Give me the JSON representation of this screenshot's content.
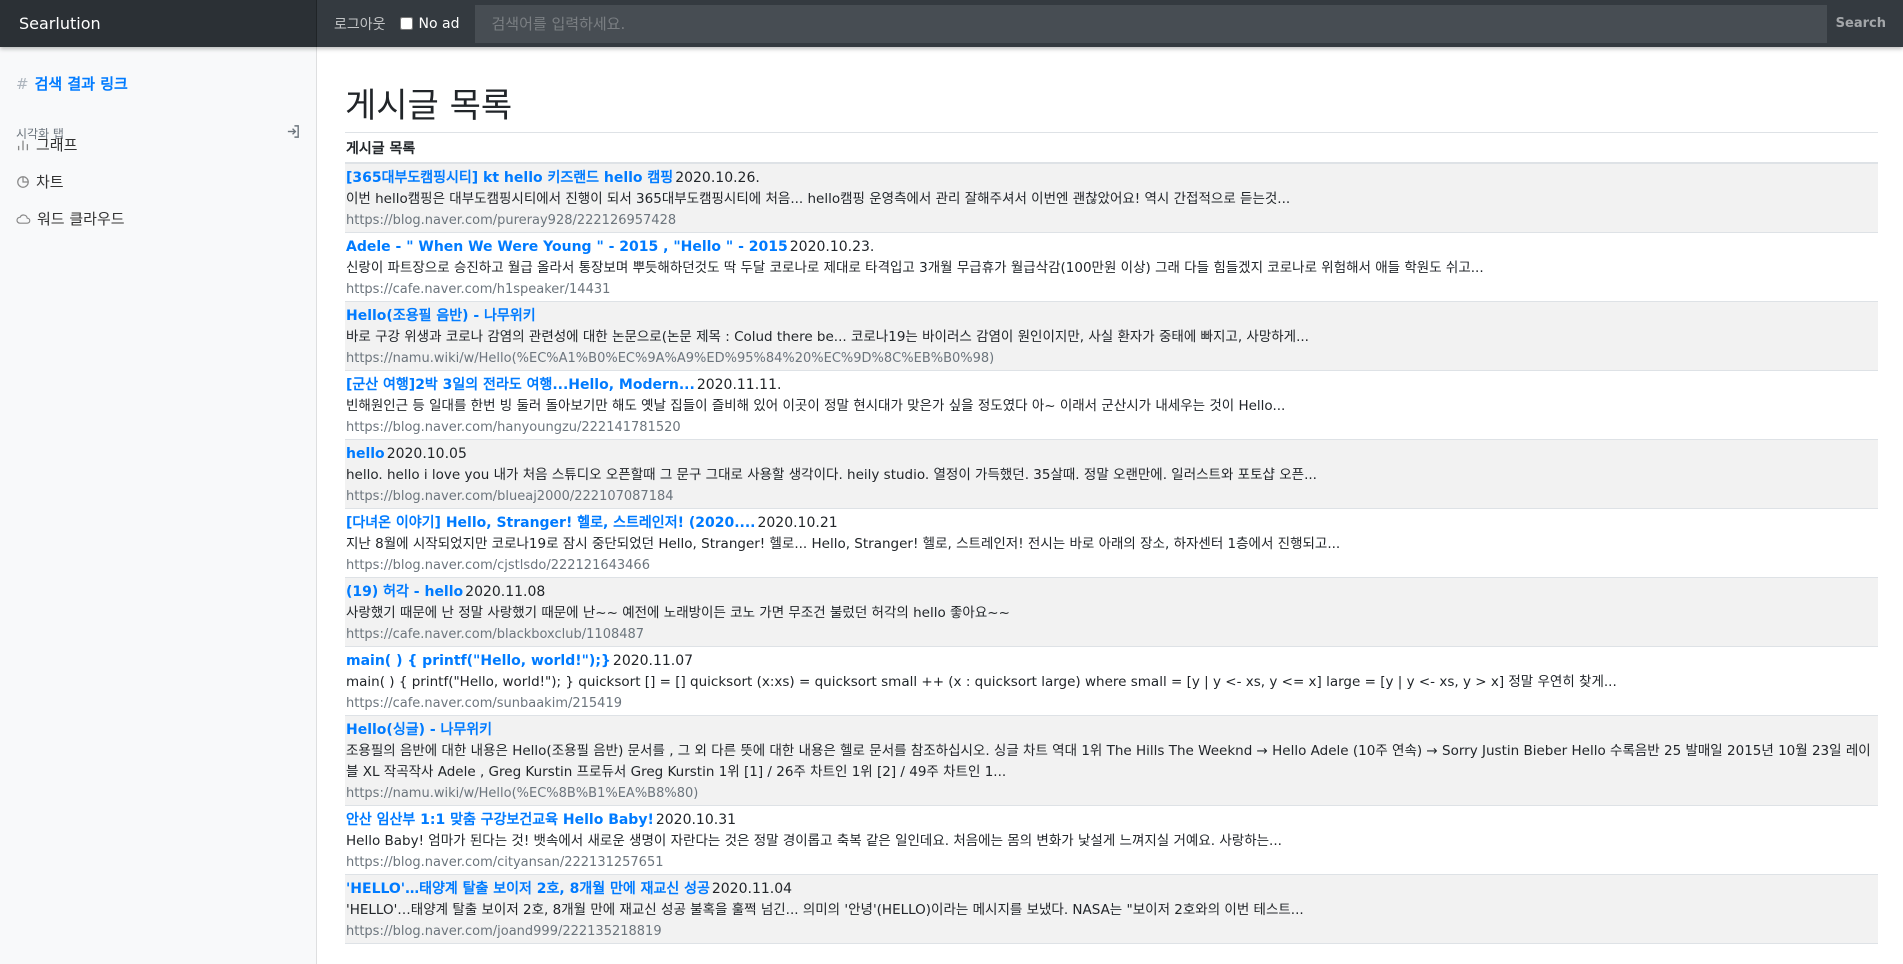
{
  "topbar": {
    "brand": "Searlution",
    "logout": "로그아웃",
    "noad_label": "No ad",
    "search_placeholder": "검색어를 입력하세요.",
    "search_button": "Search"
  },
  "sidebar": {
    "link": "검색 결과 링크",
    "heading": "시각화 탭",
    "items": [
      {
        "label": "그래프",
        "icon": "bar-chart-icon"
      },
      {
        "label": "차트",
        "icon": "pie-chart-icon"
      },
      {
        "label": "워드 클라우드",
        "icon": "cloud-icon"
      }
    ]
  },
  "main": {
    "title": "게시글 목록",
    "subtitle": "게시글 목록",
    "results": [
      {
        "title": "[365대부도캠핑시티] kt hello 키즈랜드 hello 캠핑",
        "date": "2020.10.26.",
        "snippet": "이번 hello캠핑은 대부도캠핑시티에서 진행이 되서 365대부도캠핑시티에 처음... hello캠핑 운영측에서 관리 잘해주셔서 이번엔 괜찮았어요! 역시 간접적으로 듣는것...",
        "url": "https://blog.naver.com/pureray928/222126957428"
      },
      {
        "title": "Adele - \" When We Were Young \" - 2015 , \"Hello \" - 2015",
        "date": "2020.10.23.",
        "snippet": "신랑이 파트장으로 승진하고 월급 올라서 통장보며 뿌듯해하던것도 딱 두달 코로나로 제대로 타격입고 3개월 무급휴가 월급삭감(100만원 이상) 그래 다들 힘들겠지 코로나로 위험해서 애들 학원도 쉬고...",
        "url": "https://cafe.naver.com/h1speaker/14431"
      },
      {
        "title": "Hello(조용필 음반) - 나무위키",
        "date": "",
        "snippet": "바로 구강 위생과 코로나 감염의 관련성에 대한 논문으로(논문 제목 : Colud there be... 코로나19는 바이러스 감염이 원인이지만, 사실 환자가 중태에 빠지고, 사망하게...",
        "url": "https://namu.wiki/w/Hello(%EC%A1%B0%EC%9A%A9%ED%95%84%20%EC%9D%8C%EB%B0%98)"
      },
      {
        "title": "[군산 여행]2박 3일의 전라도 여행...Hello, Modern...",
        "date": "2020.11.11.",
        "snippet": "빈해원인근 등 일대를 한번 빙 둘러 돌아보기만 해도 옛날 집들이 즐비해 있어 이곳이 정말 현시대가 맞은가 싶을 정도였다 아~ 이래서 군산시가 내세우는 것이 Hello...",
        "url": "https://blog.naver.com/hanyoungzu/222141781520"
      },
      {
        "title": "hello",
        "date": "2020.10.05",
        "snippet": "hello. hello i love you 내가 처음 스튜디오 오픈할때 그 문구 그대로 사용할 생각이다. heily studio. 열정이 가득했던. 35살때. 정말 오랜만에. 일러스트와 포토샵 오픈...",
        "url": "https://blog.naver.com/blueaj2000/222107087184"
      },
      {
        "title": "[다녀온 이야기] Hello, Stranger! 헬로, 스트레인저! (2020....",
        "date": "2020.10.21",
        "snippet": "지난 8월에 시작되었지만 코로나19로 잠시 중단되었던 Hello, Stranger! 헬로... Hello, Stranger! 헬로, 스트레인저! 전시는 바로 아래의 장소, 하자센터 1층에서 진행되고...",
        "url": "https://blog.naver.com/cjstlsdo/222121643466"
      },
      {
        "title": "(19) 허각 - hello",
        "date": "2020.11.08",
        "snippet": "사랑했기 때문에 난 정말 사랑했기 때문에 난~~ 예전에 노래방이든 코노 가면 무조건 불렀던 허각의 hello 좋아요~~",
        "url": "https://cafe.naver.com/blackboxclub/1108487"
      },
      {
        "title": "main( ) { printf(\"Hello, world!\");}",
        "date": "2020.11.07",
        "snippet": "main( ) { printf(\"Hello, world!\"); } quicksort [] = [] quicksort (x:xs) = quicksort small ++ (x : quicksort large) where small = [y | y <- xs, y <= x] large = [y | y <- xs, y > x] 정말 우연히 찾게...",
        "url": "https://cafe.naver.com/sunbaakim/215419"
      },
      {
        "title": "Hello(싱글) - 나무위키",
        "date": "",
        "snippet": "조용필의 음반에 대한 내용은 Hello(조용필 음반) 문서를 , 그 외 다른 뜻에 대한 내용은 헬로 문서를 참조하십시오. 싱글 차트 역대 1위 The Hills The Weeknd → Hello Adele (10주 연속) → Sorry Justin Bieber Hello 수록음반 25 발매일 2015년 10월 23일 레이블 XL 작곡작사 Adele , Greg Kurstin 프로듀서 Greg Kurstin 1위 [1] / 26주 차트인 1위 [2] / 49주 차트인 1...",
        "url": "https://namu.wiki/w/Hello(%EC%8B%B1%EA%B8%80)",
        "wrap": true
      },
      {
        "title": "안산 임산부 1:1 맞춤 구강보건교육 Hello Baby!",
        "date": "2020.10.31",
        "snippet": "Hello Baby! 엄마가 된다는 것! 뱃속에서 새로운 생명이 자란다는 것은 정말 경이롭고 축복 같은 일인데요. 처음에는 몸의 변화가 낯설게 느껴지실 거예요. 사랑하는...",
        "url": "https://blog.naver.com/cityansan/222131257651"
      },
      {
        "title": "'HELLO'…태양계 탈출 보이저 2호, 8개월 만에 재교신 성공",
        "date": "2020.11.04",
        "snippet": "'HELLO'…태양계 탈출 보이저 2호, 8개월 만에 재교신 성공 불혹을 훌쩍 넘긴... 의미의 '안녕'(HELLO)이라는 메시지를 보냈다. NASA는 \"보이저 2호와의 이번 테스트...",
        "url": "https://blog.naver.com/joand999/222135218819"
      }
    ]
  }
}
